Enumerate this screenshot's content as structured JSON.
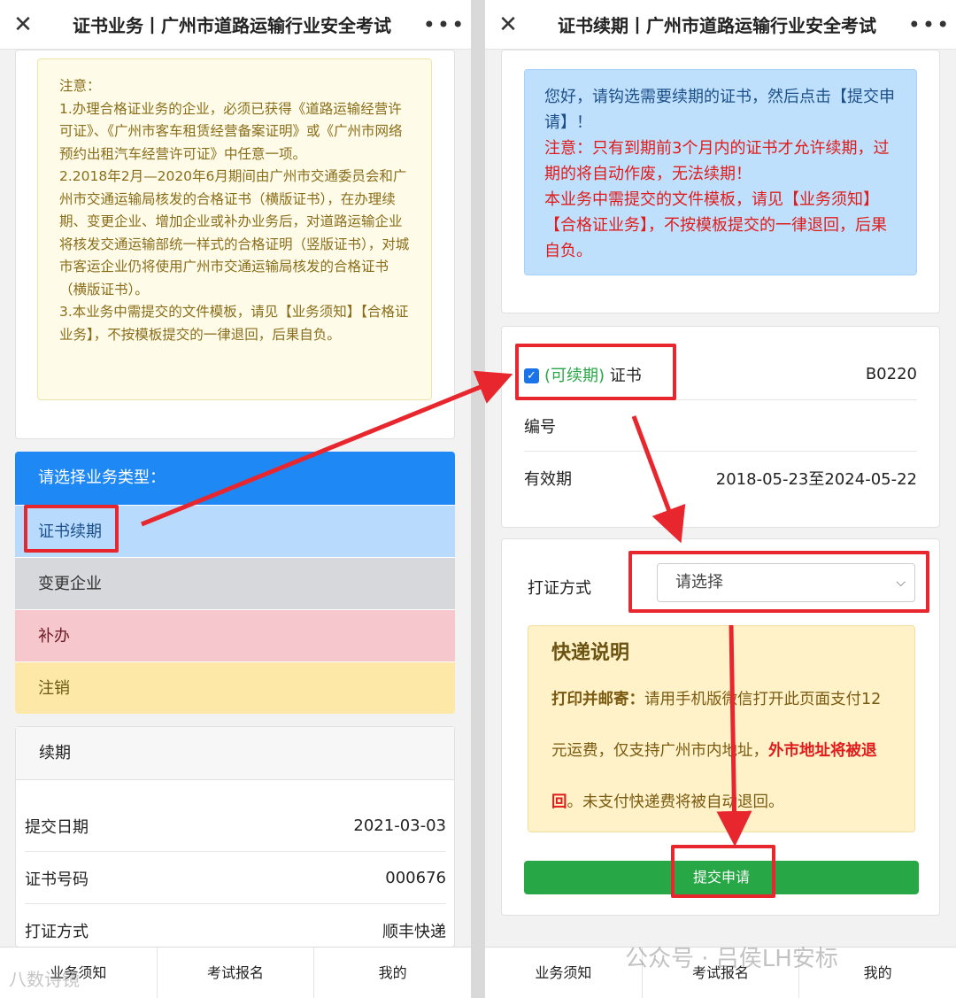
{
  "left": {
    "title": "证书业务丨广州市道路运输行业安全考试",
    "notice": {
      "lines": [
        "注意：",
        "1.办理合格证业务的企业，必须已获得《道路运输经营许可证》、《广州市客车租赁经营备案证明》或《广州市网络预约出租汽车经营许可证》中任意一项。",
        "2.2018年2月—2020年6月期间由广州市交通委员会和广州市交通运输局核发的合格证书（横版证书），在办理续期、变更企业、增加企业或补办业务后，对道路运输企业将核发交通运输部统一样式的合格证明（竖版证书），对城市客运企业仍将使用广州市交通运输局核发的合格证书（横版证书）。",
        "3.本业务中需提交的文件模板，请见【业务须知】【合格证业务】，不按模板提交的一律退回，后果自负。"
      ]
    },
    "business_type": {
      "header": "请选择业务类型：",
      "options": [
        "证书续期",
        "变更企业",
        "补办",
        "注销"
      ]
    },
    "record": {
      "header": "续期",
      "rows": [
        {
          "label": "提交日期",
          "value": "2021-03-03"
        },
        {
          "label": "证书号码",
          "value": "000676"
        },
        {
          "label": "打证方式",
          "value": "顺丰快递"
        }
      ]
    },
    "tabs": [
      "业务须知",
      "考试报名",
      "我的"
    ]
  },
  "right": {
    "title": "证书续期丨广州市道路运输行业安全考试",
    "info": {
      "line1": "您好，请钩选需要续期的证书，然后点击【提交申请】！",
      "line2": "注意：只有到期前3个月内的证书才允许续期，过期的将自动作废，无法续期！",
      "line3": "本业务中需提交的文件模板，请见【业务须知】【合格证业务】，不按模板提交的一律退回，后果自负。"
    },
    "certificate": {
      "check_label_prefix": "(可续期)",
      "check_label": "证书",
      "number_label": "编号",
      "number_value": "B0220",
      "validity_label": "有效期",
      "validity_value": "2018-05-23至2024-05-22"
    },
    "print_method": {
      "label": "打证方式",
      "placeholder": "请选择"
    },
    "express": {
      "title": "快递说明",
      "bold_lead": "打印并邮寄：",
      "text1": "请用手机版微信打开此页面支付12元运费，仅支持广州市内地址，",
      "red_text": "外市地址将被退回",
      "text2": "。未支付快递费将被自动退回。"
    },
    "submit_label": "提交申请",
    "tabs": [
      "业务须知",
      "考试报名",
      "我的"
    ]
  },
  "watermark": "公众号 · 吕侯LH安标",
  "watermark_left": "八数诗镜",
  "colors": {
    "accent_blue": "#1e88f5",
    "highlight_red": "#e8262d",
    "submit_green": "#27a745"
  }
}
